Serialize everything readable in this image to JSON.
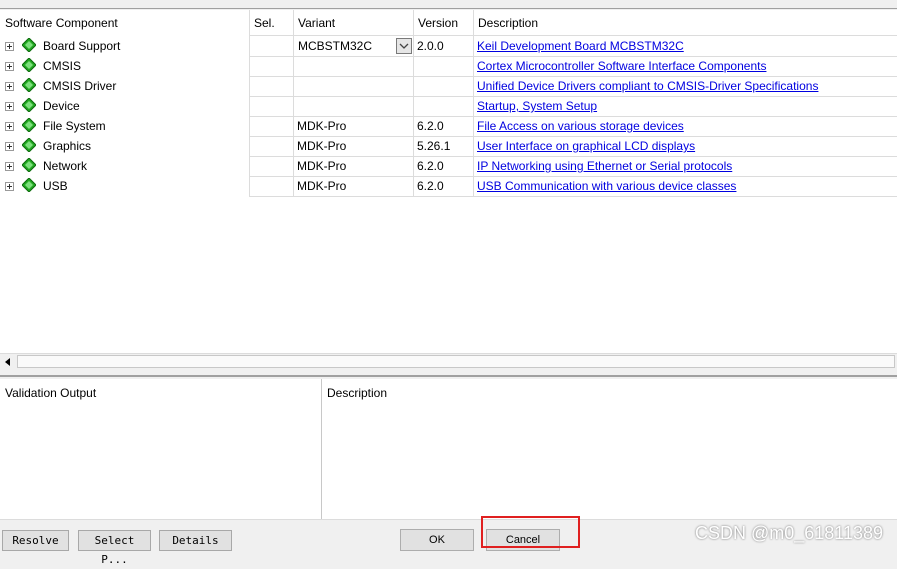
{
  "columns": {
    "component": "Software Component",
    "sel": "Sel.",
    "variant": "Variant",
    "version": "Version",
    "description": "Description"
  },
  "components": [
    {
      "name": "Board Support",
      "variant": "MCBSTM32C",
      "version": "2.0.0",
      "description": "Keil Development Board MCBSTM32C"
    },
    {
      "name": "CMSIS",
      "variant": "",
      "version": "",
      "description": "Cortex Microcontroller Software Interface Components"
    },
    {
      "name": "CMSIS Driver",
      "variant": "",
      "version": "",
      "description": "Unified Device Drivers compliant to CMSIS-Driver Specifications"
    },
    {
      "name": "Device",
      "variant": "",
      "version": "",
      "description": "Startup, System Setup"
    },
    {
      "name": "File System",
      "variant": "MDK-Pro",
      "version": "6.2.0",
      "description": "File Access on various storage devices"
    },
    {
      "name": "Graphics",
      "variant": "MDK-Pro",
      "version": "5.26.1",
      "description": "User Interface on graphical LCD displays"
    },
    {
      "name": "Network",
      "variant": "MDK-Pro",
      "version": "6.2.0",
      "description": "IP Networking using Ethernet or Serial protocols"
    },
    {
      "name": "USB",
      "variant": "MDK-Pro",
      "version": "6.2.0",
      "description": "USB Communication with various device classes"
    }
  ],
  "validation": {
    "output_label": "Validation Output",
    "description_label": "Description"
  },
  "buttons": {
    "resolve": "Resolve",
    "select_packs": "Select P...",
    "details": "Details",
    "ok": "OK",
    "cancel": "Cancel"
  },
  "watermark": "CSDN @m0_61811389",
  "colors": {
    "link": "#0000e0",
    "gem": "#22aa22",
    "highlight": "#e02020"
  },
  "icons": {
    "expand": "plus-box-icon",
    "component": "green-gem-icon",
    "dropdown": "chevron-down-icon",
    "scroll_left": "arrow-left-icon"
  }
}
